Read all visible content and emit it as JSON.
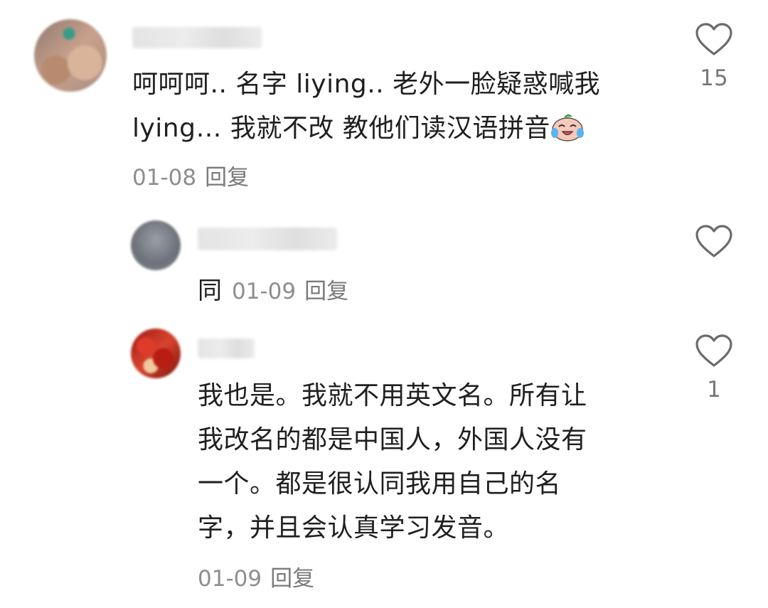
{
  "comments": [
    {
      "text_line1": "呵呵呵.. 名字 liying.. 老外一脸疑惑喊我",
      "text_line2": "lying… 我就不改 教他们读汉语拼音",
      "emoji": "laughing-crying-emoji",
      "date": "01-08",
      "reply_label": "回复",
      "like_count": "15"
    },
    {
      "inline_text": "同",
      "date": "01-09",
      "reply_label": "回复",
      "like_count": ""
    },
    {
      "lines": [
        "我也是。我就不用英文名。所有让",
        "我改名的都是中国人，外国人没有",
        "一个。都是很认同我用自己的名",
        "字，并且会认真学习发音。"
      ],
      "date": "01-09",
      "reply_label": "回复",
      "like_count": "1"
    }
  ],
  "icons": {
    "like": "heart-outline-icon"
  },
  "colors": {
    "text": "#1f1f1f",
    "meta": "#8e8e8e",
    "icon": "#6b6b6b"
  }
}
